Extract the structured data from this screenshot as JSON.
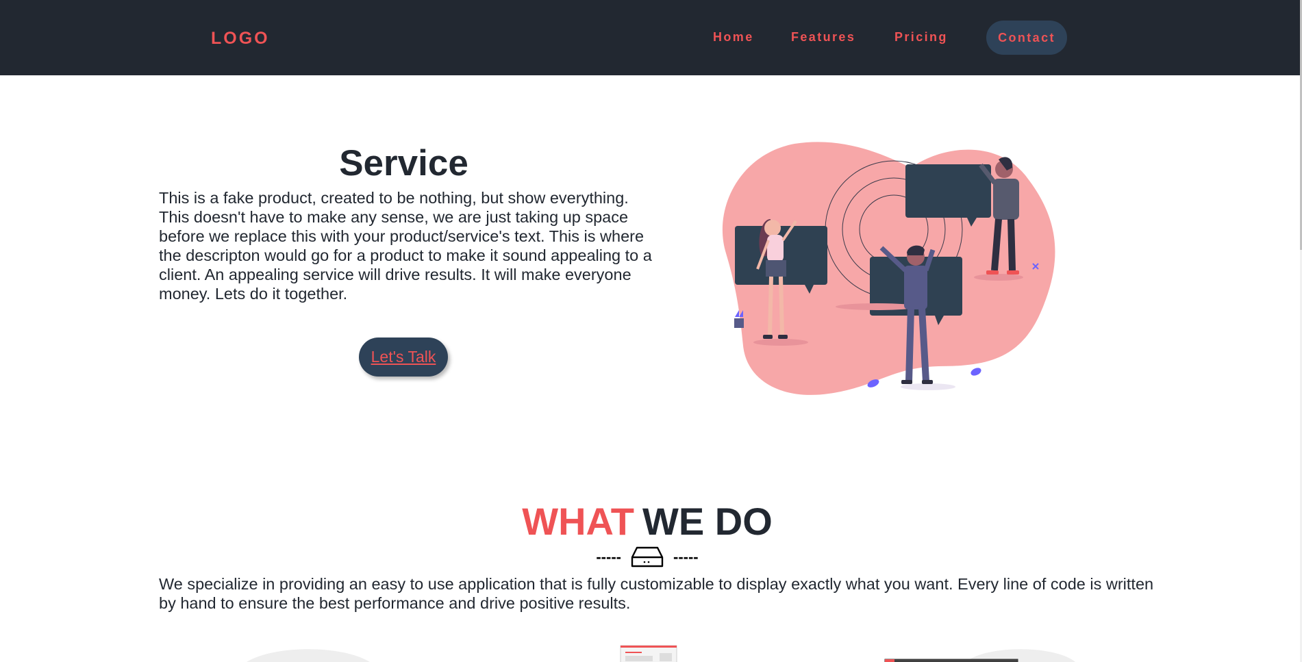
{
  "nav": {
    "logo": "LOGO",
    "items": [
      "Home",
      "Features",
      "Pricing"
    ],
    "contact": "Contact"
  },
  "hero": {
    "title": "Service",
    "body": "This is a fake product, created to be nothing, but show everything. This doesn't have to make any sense, we are just taking up space before we replace this with your product/service's text. This is where the descripton would go for a product to make it sound appealing to a client. An appealing service will drive results. It will make everyone money. Lets do it together.",
    "cta": "Let's Talk",
    "illustration_icon": "people-with-speech-bubbles-illustration"
  },
  "what_we_do": {
    "title_accent": "WHAT",
    "title_main": "WE DO",
    "divider_left": "-----",
    "divider_right": "-----",
    "divider_icon": "hard-drive-icon",
    "body": "We specialize in providing an easy to use application that is fully customizable to display exactly what you want. Every line of code is written by hand to ensure the best performance and drive positive results."
  },
  "colors": {
    "nav_bg": "#222831",
    "accent": "#ef5355",
    "button_bg": "#2e4258",
    "text": "#222831",
    "blob": "#f7a7a8"
  }
}
